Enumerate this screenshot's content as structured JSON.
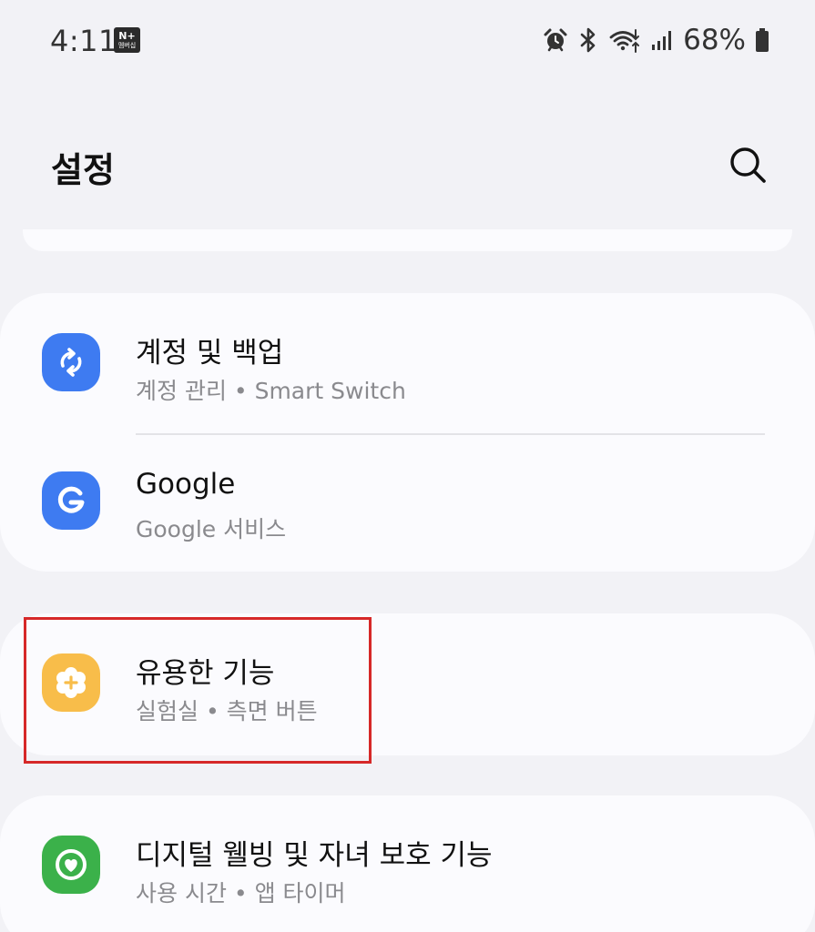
{
  "status_bar": {
    "time": "4:11",
    "badge_top": "N+",
    "badge_bottom": "멤버십",
    "battery_percent": "68%",
    "icons": [
      "alarm-icon",
      "bluetooth-icon",
      "wifi-icon",
      "signal-icon",
      "battery-icon"
    ]
  },
  "header": {
    "title": "설정",
    "search_icon": "search-icon"
  },
  "items": [
    {
      "title": "계정 및 백업",
      "subtitle": "계정 관리 • Smart Switch",
      "icon": "sync-icon",
      "icon_color": "#3e7bf1"
    },
    {
      "title": "Google",
      "subtitle": "Google 서비스",
      "icon": "google-icon",
      "icon_color": "#3e7bf1"
    },
    {
      "title": "유용한 기능",
      "subtitle": "실험실 • 측면 버튼",
      "icon": "advanced-features-icon",
      "icon_color": "#f8bd4a"
    },
    {
      "title": "디지털 웰빙 및 자녀 보호 기능",
      "subtitle": "사용 시간 • 앱 타이머",
      "icon": "digital-wellbeing-icon",
      "icon_color": "#3bb14a"
    }
  ],
  "highlight_color": "#d62828"
}
